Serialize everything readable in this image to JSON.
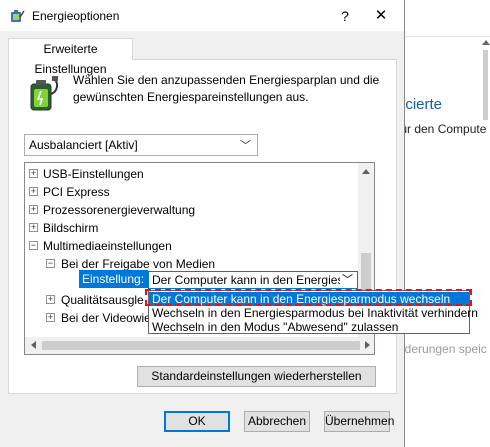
{
  "background_window": {
    "heading": "ncierte",
    "subtext": "für den Compute",
    "footer": "nderungen speic"
  },
  "window": {
    "title": "Energieoptionen",
    "help_label": "?",
    "close_label": "✕"
  },
  "tabs": [
    {
      "label": "Erweiterte Einstellungen"
    }
  ],
  "description": "Wählen Sie den anzupassenden Energiesparplan und die gewünschten Energiespareinstellungen aus.",
  "plan_select": {
    "value": "Ausbalanciert [Aktiv]"
  },
  "tree": {
    "items": [
      {
        "label": "USB-Einstellungen",
        "expander": "+"
      },
      {
        "label": "PCI Express",
        "expander": "+"
      },
      {
        "label": "Prozessorenergieverwaltung",
        "expander": "+"
      },
      {
        "label": "Bildschirm",
        "expander": "+"
      },
      {
        "label": "Multimediaeinstellungen",
        "expander": "−"
      },
      {
        "label": "Bei der Freigabe von Medien",
        "expander": "−"
      },
      {
        "label": "Qualitätsausgle",
        "expander": "+"
      },
      {
        "label": "Bei der Videowie",
        "expander": "+"
      }
    ],
    "setting_label": "Einstellung:",
    "setting_value": "Der Computer kann in den Energiesp"
  },
  "dropdown": {
    "options": [
      "Der Computer kann in den Energiesparmodus wechseln",
      "Wechseln in den Energiesparmodus bei Inaktivität verhindern",
      "Wechseln in den Modus \"Abwesend\" zulassen"
    ],
    "selected_index": 0
  },
  "buttons": {
    "restore": "Standardeinstellungen wiederherstellen",
    "ok": "OK",
    "cancel": "Abbrechen",
    "apply": "Übernehmen"
  },
  "colors": {
    "accent": "#0078d7",
    "highlight_box": "#e0141e"
  }
}
